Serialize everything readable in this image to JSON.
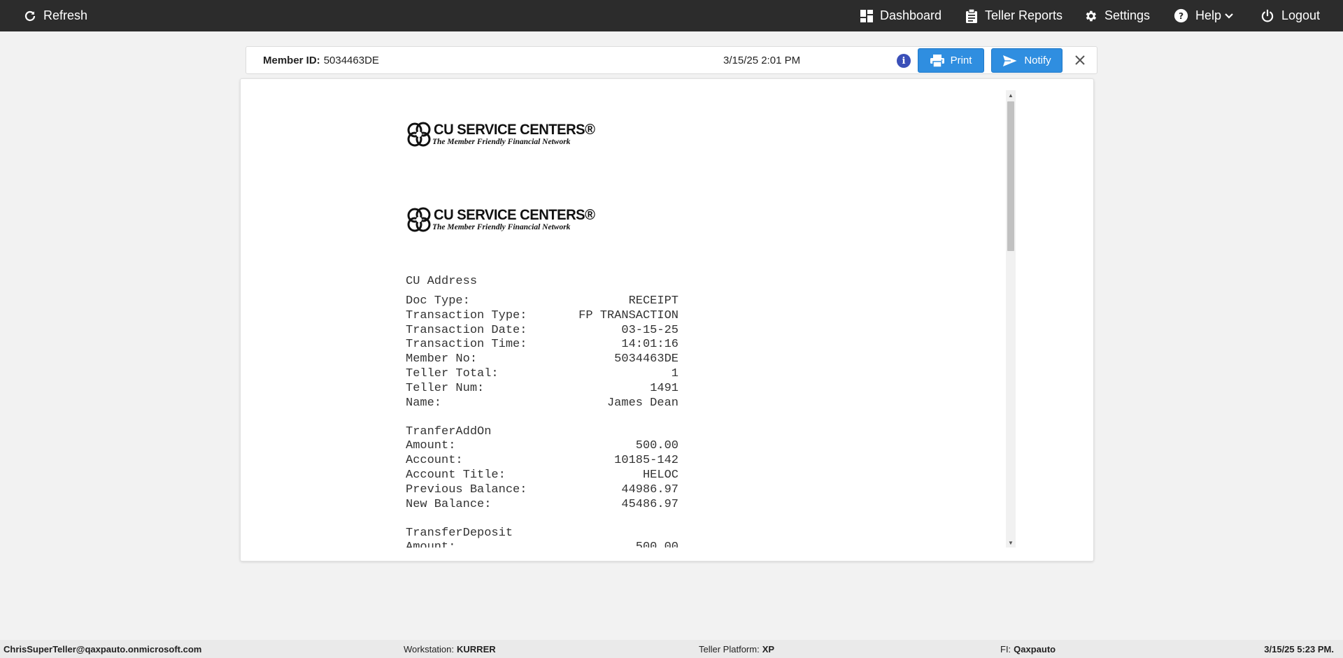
{
  "nav": {
    "refresh": "Refresh",
    "dashboard": "Dashboard",
    "teller_reports": "Teller Reports",
    "settings": "Settings",
    "help": "Help",
    "logout": "Logout"
  },
  "header": {
    "member_label": "Member ID:",
    "member_id": "5034463DE",
    "datetime": "3/15/25 2:01 PM",
    "print": "Print",
    "notify": "Notify"
  },
  "logo": {
    "name": "CU SERVICE CENTERS®",
    "tagline": "The Member Friendly Financial Network"
  },
  "receipt": {
    "address": "CU Address",
    "rows": [
      {
        "label": "Doc Type:",
        "value": "RECEIPT"
      },
      {
        "label": "Transaction Type:",
        "value": "FP TRANSACTION"
      },
      {
        "label": "Transaction Date:",
        "value": "03-15-25"
      },
      {
        "label": "Transaction Time:",
        "value": "14:01:16"
      },
      {
        "label": "Member No:",
        "value": "5034463DE"
      },
      {
        "label": "Teller Total:",
        "value": "1"
      },
      {
        "label": "Teller Num:",
        "value": "1491"
      },
      {
        "label": "Name:",
        "value": "James Dean"
      }
    ],
    "section1": {
      "title": "TranferAddOn",
      "rows": [
        {
          "label": "Amount:",
          "value": "500.00"
        },
        {
          "label": "Account:",
          "value": "10185-142"
        },
        {
          "label": "Account Title:",
          "value": "HELOC"
        },
        {
          "label": "Previous Balance:",
          "value": "44986.97"
        },
        {
          "label": "New Balance:",
          "value": "45486.97"
        }
      ]
    },
    "section2": {
      "title": "TransferDeposit",
      "rows": [
        {
          "label": "Amount:",
          "value": "500.00"
        }
      ]
    }
  },
  "footer": {
    "user": "ChrisSuperTeller@qaxpauto.onmicrosoft.com",
    "workstation_label": "Workstation:",
    "workstation": "KURRER",
    "platform_label": "Teller Platform:",
    "platform": "XP",
    "fi_label": "FI:",
    "fi": "Qaxpauto",
    "time": "3/15/25 5:23 PM."
  },
  "colors": {
    "nav_bg": "#2c2c2c",
    "button_blue": "#2f8ee0",
    "info_icon": "#3a4fb8"
  }
}
